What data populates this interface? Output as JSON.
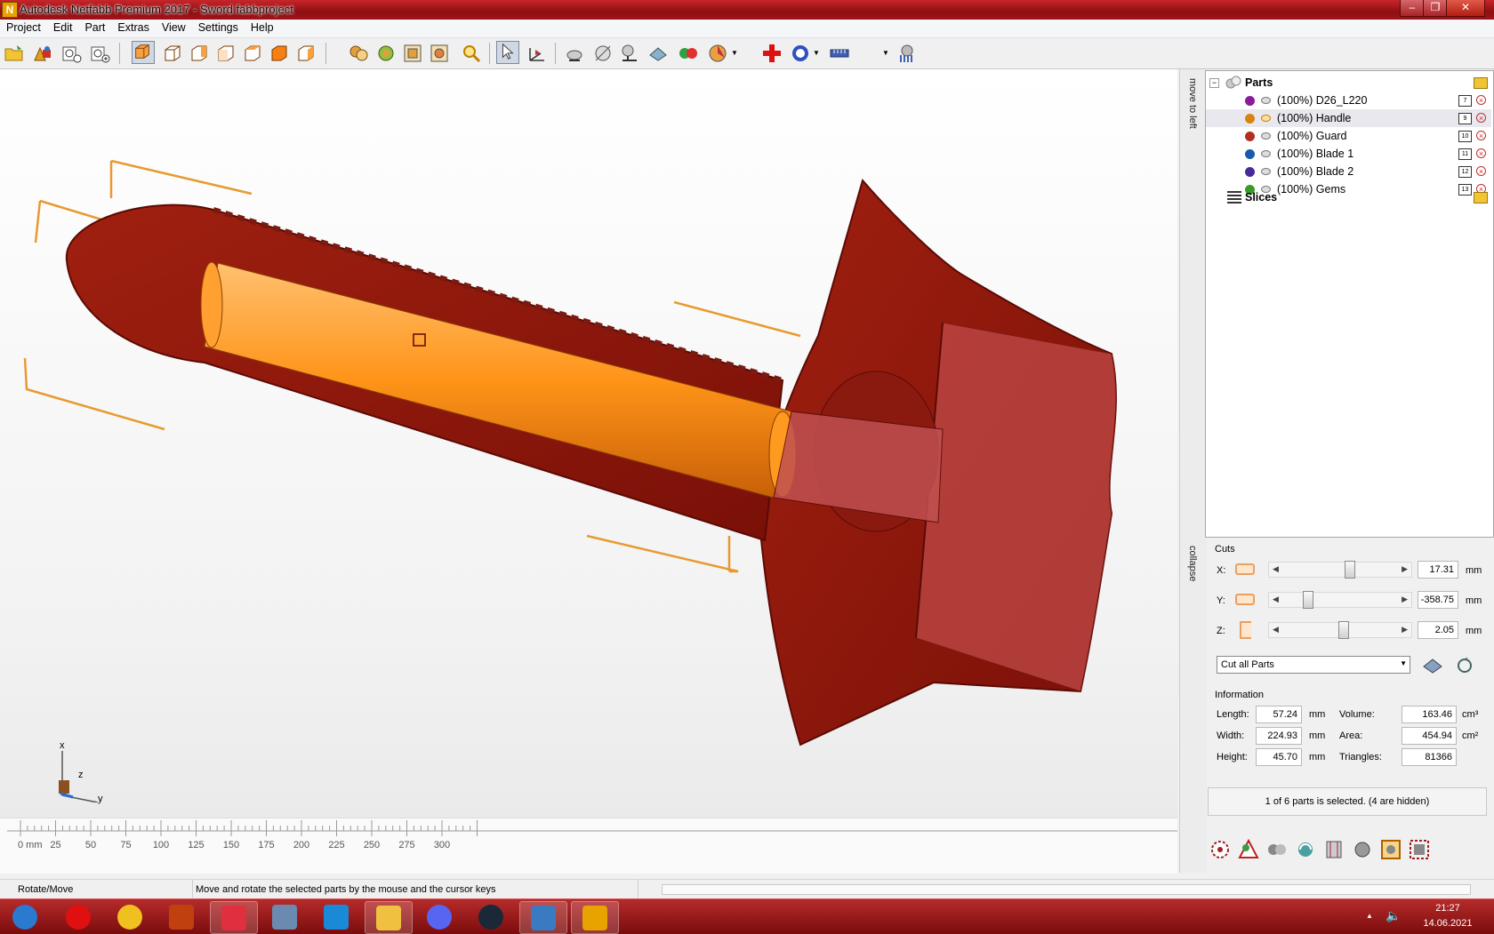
{
  "window": {
    "title": "Autodesk Netfabb Premium 2017 - Sword.fabbproject",
    "app_icon": "N"
  },
  "menu": [
    "Project",
    "Edit",
    "Part",
    "Extras",
    "View",
    "Settings",
    "Help"
  ],
  "toolbar": {
    "icons": [
      "open-project-icon",
      "add-part-icon",
      "new-part-icon",
      "import-icon",
      "view-front-icon",
      "view-back-icon",
      "view-left-icon",
      "view-right-icon",
      "view-top-icon",
      "view-bottom-icon",
      "view-perspective-icon",
      "zoom-all-icon",
      "zoom-selection-icon",
      "zoom-window-icon",
      "zoom-magnify-icon",
      "select-arrow-icon",
      "rotate-move-icon",
      "shading-icon",
      "transparency-icon",
      "section-icon",
      "repair-icon",
      "boolean-icon",
      "color-picker-icon",
      "add-part-red-icon",
      "measure-dropdown-icon",
      "ruler-icon",
      "text-abc-icon",
      "support-icon"
    ],
    "text_button": "abc"
  },
  "viewport": {
    "axes": {
      "x": "x",
      "y": "y",
      "z": "z"
    },
    "ruler": {
      "unit_label": "0 mm",
      "ticks": [
        "25",
        "50",
        "75",
        "100",
        "125",
        "150",
        "175",
        "200",
        "225",
        "250",
        "275",
        "300"
      ]
    }
  },
  "side_tabs": {
    "move": "move to left",
    "collapse": "collapse"
  },
  "tree": {
    "parts_label": "Parts",
    "slices_label": "Slices",
    "items": [
      {
        "label": "(100%) D26_L220",
        "num": "7",
        "color": "#8a1a9a"
      },
      {
        "label": "(100%) Handle",
        "num": "9",
        "color": "#d78510"
      },
      {
        "label": "(100%) Guard",
        "num": "10",
        "color": "#b03020"
      },
      {
        "label": "(100%) Blade 1",
        "num": "11",
        "color": "#1a5aaa"
      },
      {
        "label": "(100%) Blade 2",
        "num": "12",
        "color": "#4a2a9a"
      },
      {
        "label": "(100%) Gems",
        "num": "13",
        "color": "#3a9a2a"
      }
    ]
  },
  "cuts": {
    "title": "Cuts",
    "rows": [
      {
        "axis": "X:",
        "value": "17.31",
        "unit": "mm",
        "position": 0.55
      },
      {
        "axis": "Y:",
        "value": "-358.75",
        "unit": "mm",
        "position": 0.2
      },
      {
        "axis": "Z:",
        "value": "2.05",
        "unit": "mm",
        "position": 0.5
      }
    ],
    "mode_select": "Cut all Parts"
  },
  "information": {
    "title": "Information",
    "length": {
      "label": "Length:",
      "value": "57.24",
      "unit": "mm"
    },
    "width": {
      "label": "Width:",
      "value": "224.93",
      "unit": "mm"
    },
    "height": {
      "label": "Height:",
      "value": "45.70",
      "unit": "mm"
    },
    "volume": {
      "label": "Volume:",
      "value": "163.46",
      "unit": "cm³"
    },
    "area": {
      "label": "Area:",
      "value": "454.94",
      "unit": "cm²"
    },
    "triangles": {
      "label": "Triangles:",
      "value": "81366"
    }
  },
  "selection_status": "1 of 6 parts is selected. (4 are hidden)",
  "statusbar": {
    "mode": "Rotate/Move",
    "hint": "Move and rotate the selected parts by the mouse and the cursor keys"
  },
  "taskbar": {
    "apps": [
      "start-orb-icon",
      "opera-icon",
      "chrome-icon",
      "revit-icon",
      "opera-gx-icon",
      "calculator-icon",
      "battlenet-icon",
      "file-explorer-icon",
      "discord-icon",
      "steam-icon",
      "photo-viewer-icon",
      "netfabb-icon"
    ],
    "time": "21:27",
    "date": "14.06.2021"
  }
}
